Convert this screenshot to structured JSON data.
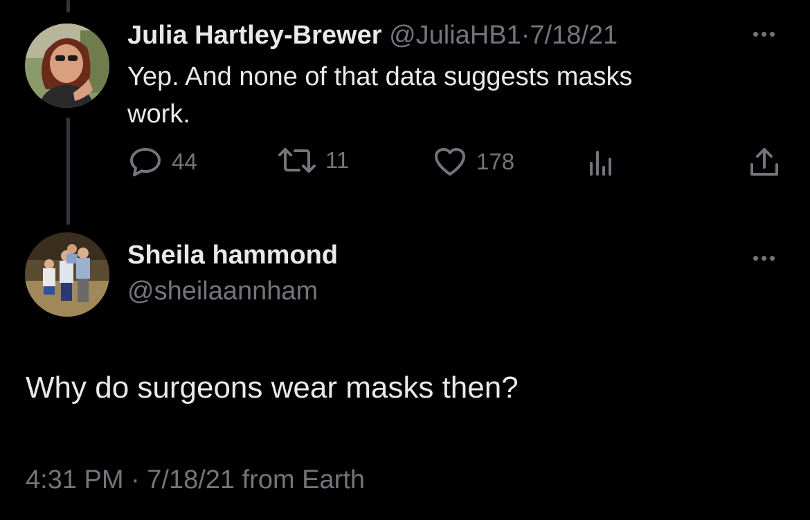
{
  "reply_tweet": {
    "author_name": "Julia Hartley-Brewer",
    "author_handle": "@JuliaHB1",
    "separator": "·",
    "date": "7/18/21",
    "text_line1": "Yep. And none of that data suggests masks",
    "text_line2": "work.",
    "actions": {
      "replies": "44",
      "retweets": "11",
      "likes": "178"
    }
  },
  "main_tweet": {
    "author_name": "Sheila hammond",
    "author_handle": "@sheilaannham",
    "text": "Why do surgeons wear masks then?",
    "meta": "4:31 PM · 7/18/21 from Earth"
  },
  "colors": {
    "background": "#000000",
    "text_primary": "#e7e9ea",
    "text_muted": "#71767b",
    "thread_line": "#333639"
  }
}
